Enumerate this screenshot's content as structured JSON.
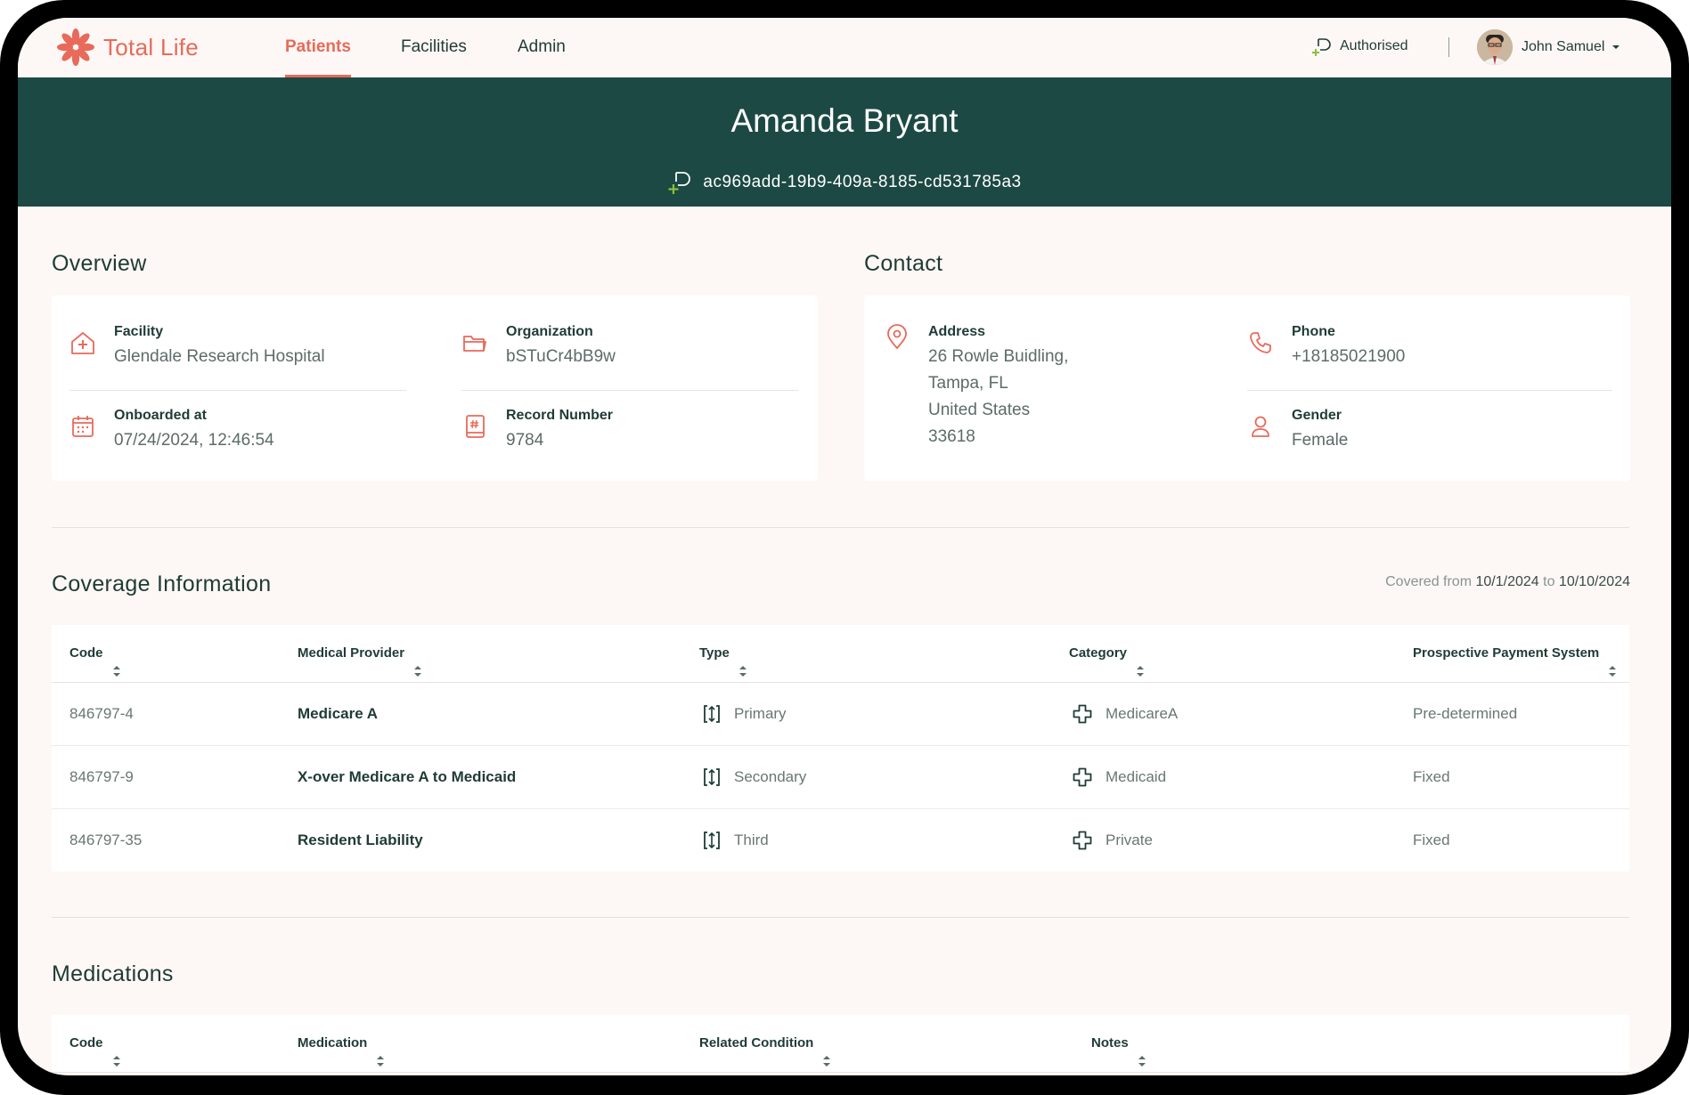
{
  "brand": {
    "name": "Total Life",
    "color": "#e86a5a"
  },
  "nav": {
    "tabs": [
      {
        "label": "Patients",
        "active": true
      },
      {
        "label": "Facilities",
        "active": false
      },
      {
        "label": "Admin",
        "active": false
      }
    ],
    "auth_status": "Authorised",
    "user_name": "John Samuel"
  },
  "patient": {
    "name": "Amanda Bryant",
    "id": "ac969add-19b9-409a-8185-cd531785a3"
  },
  "overview": {
    "title": "Overview",
    "facility": {
      "label": "Facility",
      "value": "Glendale Research Hospital"
    },
    "organization": {
      "label": "Organization",
      "value": "bSTuCr4bB9w"
    },
    "onboarded": {
      "label": "Onboarded at",
      "value": "07/24/2024, 12:46:54"
    },
    "record": {
      "label": "Record Number",
      "value": "9784"
    }
  },
  "contact": {
    "title": "Contact",
    "address": {
      "label": "Address",
      "lines": [
        "26 Rowle Buidling,",
        "Tampa, FL",
        "United States",
        "33618"
      ]
    },
    "phone": {
      "label": "Phone",
      "value": "+18185021900"
    },
    "gender": {
      "label": "Gender",
      "value": "Female"
    }
  },
  "coverage": {
    "title": "Coverage Information",
    "covered_prefix": "Covered from",
    "covered_from": "10/1/2024",
    "covered_to_word": "to",
    "covered_to": "10/10/2024",
    "columns": [
      "Code",
      "Medical Provider",
      "Type",
      "Category",
      "Prospective Payment System"
    ],
    "rows": [
      {
        "code": "846797-4",
        "provider": "Medicare A",
        "type": "Primary",
        "category": "MedicareA",
        "pps": "Pre-determined"
      },
      {
        "code": "846797-9",
        "provider": "X-over Medicare A to Medicaid",
        "type": "Secondary",
        "category": "Medicaid",
        "pps": "Fixed"
      },
      {
        "code": "846797-35",
        "provider": "Resident Liability",
        "type": "Third",
        "category": "Private",
        "pps": "Fixed"
      }
    ]
  },
  "medications": {
    "title": "Medications",
    "columns": [
      "Code",
      "Medication",
      "Related Condition",
      "Notes"
    ]
  }
}
